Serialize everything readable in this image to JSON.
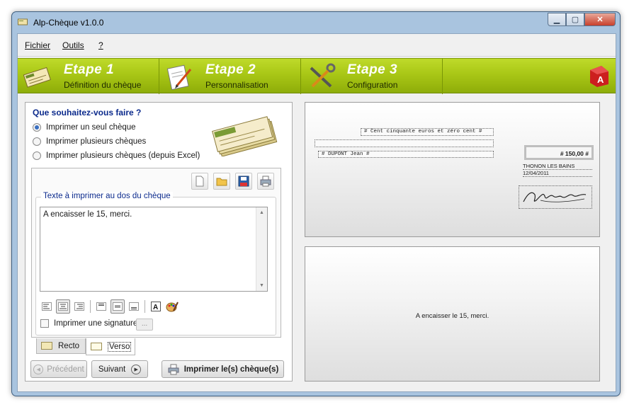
{
  "window": {
    "title": "Alp-Chèque v1.0.0",
    "min_icon": "minimize-icon",
    "max_icon": "maximize-icon",
    "close_icon": "close-icon"
  },
  "menu": {
    "items": [
      "Fichier",
      "Outils",
      "?"
    ]
  },
  "steps": [
    {
      "title": "Etape 1",
      "subtitle": "Définition du chèque",
      "icon": "cheque-icon"
    },
    {
      "title": "Etape 2",
      "subtitle": "Personnalisation",
      "icon": "pencil-paper-icon"
    },
    {
      "title": "Etape 3",
      "subtitle": "Configuration",
      "icon": "tools-icon"
    }
  ],
  "colors": {
    "banner": "#a9c716",
    "question": "#0b2a8c",
    "logo": "#cc1f1f"
  },
  "left": {
    "question": "Que souhaitez-vous faire ?",
    "options": [
      "Imprimer un seul chèque",
      "Imprimer plusieurs chèques",
      "Imprimer plusieurs chèques (depuis Excel)"
    ],
    "selected_option": 0,
    "back_text_legend": "Texte à imprimer au dos du chèque",
    "back_text": "A encaisser le 15, merci.",
    "signature_label": "Imprimer une signature",
    "signature_checked": false,
    "dots_label": "...",
    "tabs": [
      "Recto",
      "Verso"
    ],
    "active_tab": "Verso",
    "buttons": {
      "prev": "Précédent",
      "next": "Suivant",
      "print": "Imprimer le(s) chèque(s)"
    }
  },
  "preview": {
    "amount_words": "# Cent cinquante euros et zéro cent #",
    "payee": "# DUPONT Jean #",
    "amount": "# 150,00 #",
    "place": "THONON LES BAINS",
    "date": "12/04/2011",
    "verso_text": "A encaisser le 15, merci."
  }
}
